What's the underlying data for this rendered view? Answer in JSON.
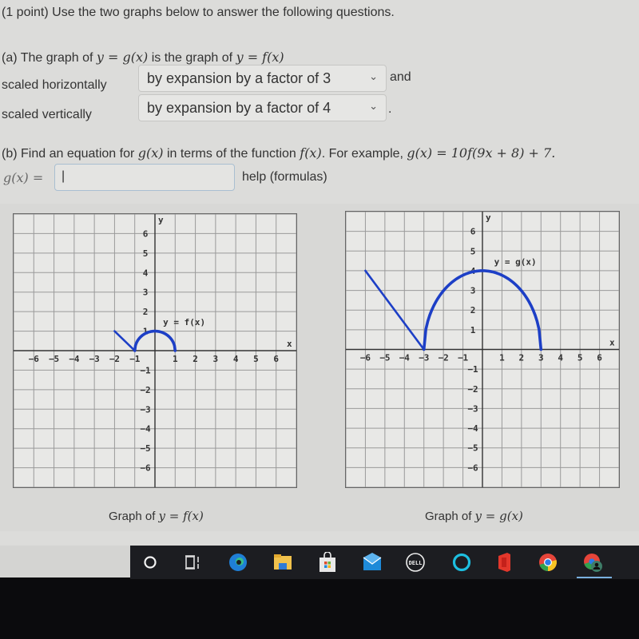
{
  "problem": {
    "intro": "(1 point) Use the two graphs below to answer the following questions.",
    "part_a": {
      "prefix": "(a) The graph of ",
      "eq1": "y = g(x)",
      "middle": " is the graph of ",
      "eq2": "y = f(x)",
      "horizontal_label": "scaled horizontally",
      "horizontal_value": "by expansion by a factor of 3",
      "and_text": "and",
      "vertical_label": "scaled vertically",
      "vertical_value": "by expansion by a factor of 4",
      "period": "."
    },
    "part_b": {
      "prefix": "(b) Find an equation for ",
      "gx": "g(x)",
      "middle": " in terms of the function ",
      "fx": "f(x)",
      "example_prefix": ". For example, ",
      "example_eq": "g(x) = 10f(9x + 8) + 7.",
      "answer_label": "g(x) =",
      "answer_value": "|",
      "help_link": "help (formulas)"
    }
  },
  "chart_data": [
    {
      "type": "line",
      "title": "Graph of y = f(x)",
      "curve_label": "y = f(x)",
      "xlabel": "x",
      "ylabel": "y",
      "xlim": [
        -7,
        7
      ],
      "ylim": [
        -7,
        7
      ],
      "x_ticks": [
        -6,
        -5,
        -4,
        -3,
        -2,
        -1,
        1,
        2,
        3,
        4,
        5,
        6
      ],
      "y_ticks": [
        -6,
        -5,
        -4,
        -3,
        -2,
        -1,
        1,
        2,
        3,
        4,
        5,
        6
      ],
      "grid": true,
      "series": [
        {
          "name": "line segment",
          "points": [
            [
              -2,
              1
            ],
            [
              -1,
              0
            ]
          ]
        },
        {
          "name": "semicircle",
          "center": [
            0,
            0
          ],
          "rx": 1,
          "ry": 1,
          "from_x": -1,
          "to_x": 1
        }
      ],
      "color": "#1d3fc6"
    },
    {
      "type": "line",
      "title": "Graph of y = g(x)",
      "curve_label": "y = g(x)",
      "xlabel": "x",
      "ylabel": "y",
      "xlim": [
        -7,
        7
      ],
      "ylim": [
        -7,
        7
      ],
      "x_ticks": [
        -6,
        -5,
        -4,
        -3,
        -2,
        -1,
        1,
        2,
        3,
        4,
        5,
        6
      ],
      "y_ticks": [
        -6,
        -5,
        -4,
        -3,
        -2,
        -1,
        1,
        2,
        3,
        4,
        5,
        6
      ],
      "grid": true,
      "series": [
        {
          "name": "line segment",
          "points": [
            [
              -6,
              4
            ],
            [
              -3,
              0
            ]
          ]
        },
        {
          "name": "semi-ellipse",
          "center": [
            0,
            0
          ],
          "rx": 3,
          "ry": 4,
          "from_x": -3,
          "to_x": 3
        }
      ],
      "color": "#1d3fc6"
    }
  ],
  "captions": {
    "left_prefix": "Graph of ",
    "left_eq": "y = f(x)",
    "right_prefix": "Graph of ",
    "right_eq": "y = g(x)"
  },
  "taskbar": {
    "icons": [
      "search-icon",
      "task-view-icon",
      "edge-icon",
      "file-explorer-icon",
      "store-icon",
      "mail-icon",
      "dell-icon",
      "alexa-icon",
      "office-icon",
      "chrome-icon",
      "chrome-profile-icon"
    ],
    "dell_text": "DELL"
  }
}
